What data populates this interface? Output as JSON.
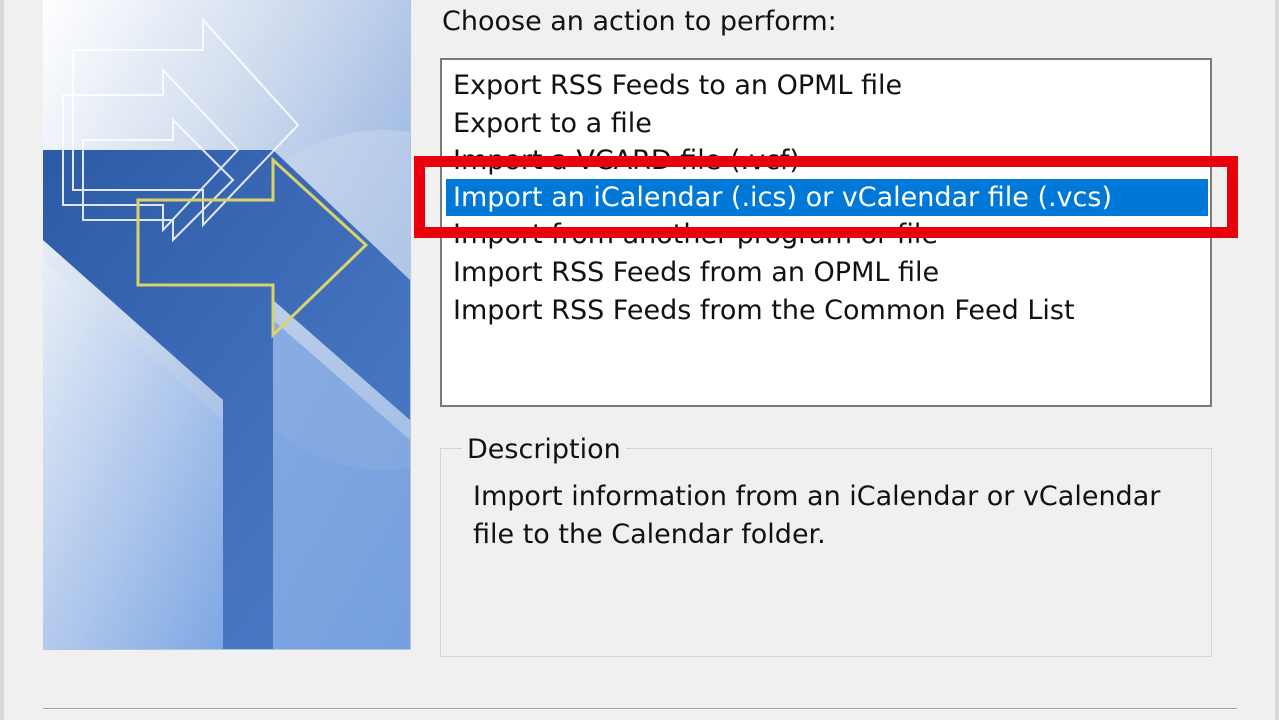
{
  "dialog": {
    "prompt": "Choose an action to perform:",
    "actions": [
      {
        "label": "Export RSS Feeds to an OPML file",
        "selected": false
      },
      {
        "label": "Export to a file",
        "selected": false
      },
      {
        "label": "Import a VCARD file (.vcf)",
        "selected": false
      },
      {
        "label": "Import an iCalendar (.ics) or vCalendar file (.vcs)",
        "selected": true
      },
      {
        "label": "Import from another program or file",
        "selected": false
      },
      {
        "label": "Import RSS Feeds from an OPML file",
        "selected": false
      },
      {
        "label": "Import RSS Feeds from the Common Feed List",
        "selected": false
      }
    ],
    "description_title": "Description",
    "description_text": "Import information from an iCalendar or vCalendar file to the Calendar folder."
  },
  "colors": {
    "selection": "#0078d7",
    "highlight_box": "#e8000d",
    "illustration_blue": "#3f6cb8",
    "arrow_outline": "#d9d36a"
  },
  "icons": {
    "illustration": "import-export-arrows-graphic"
  }
}
